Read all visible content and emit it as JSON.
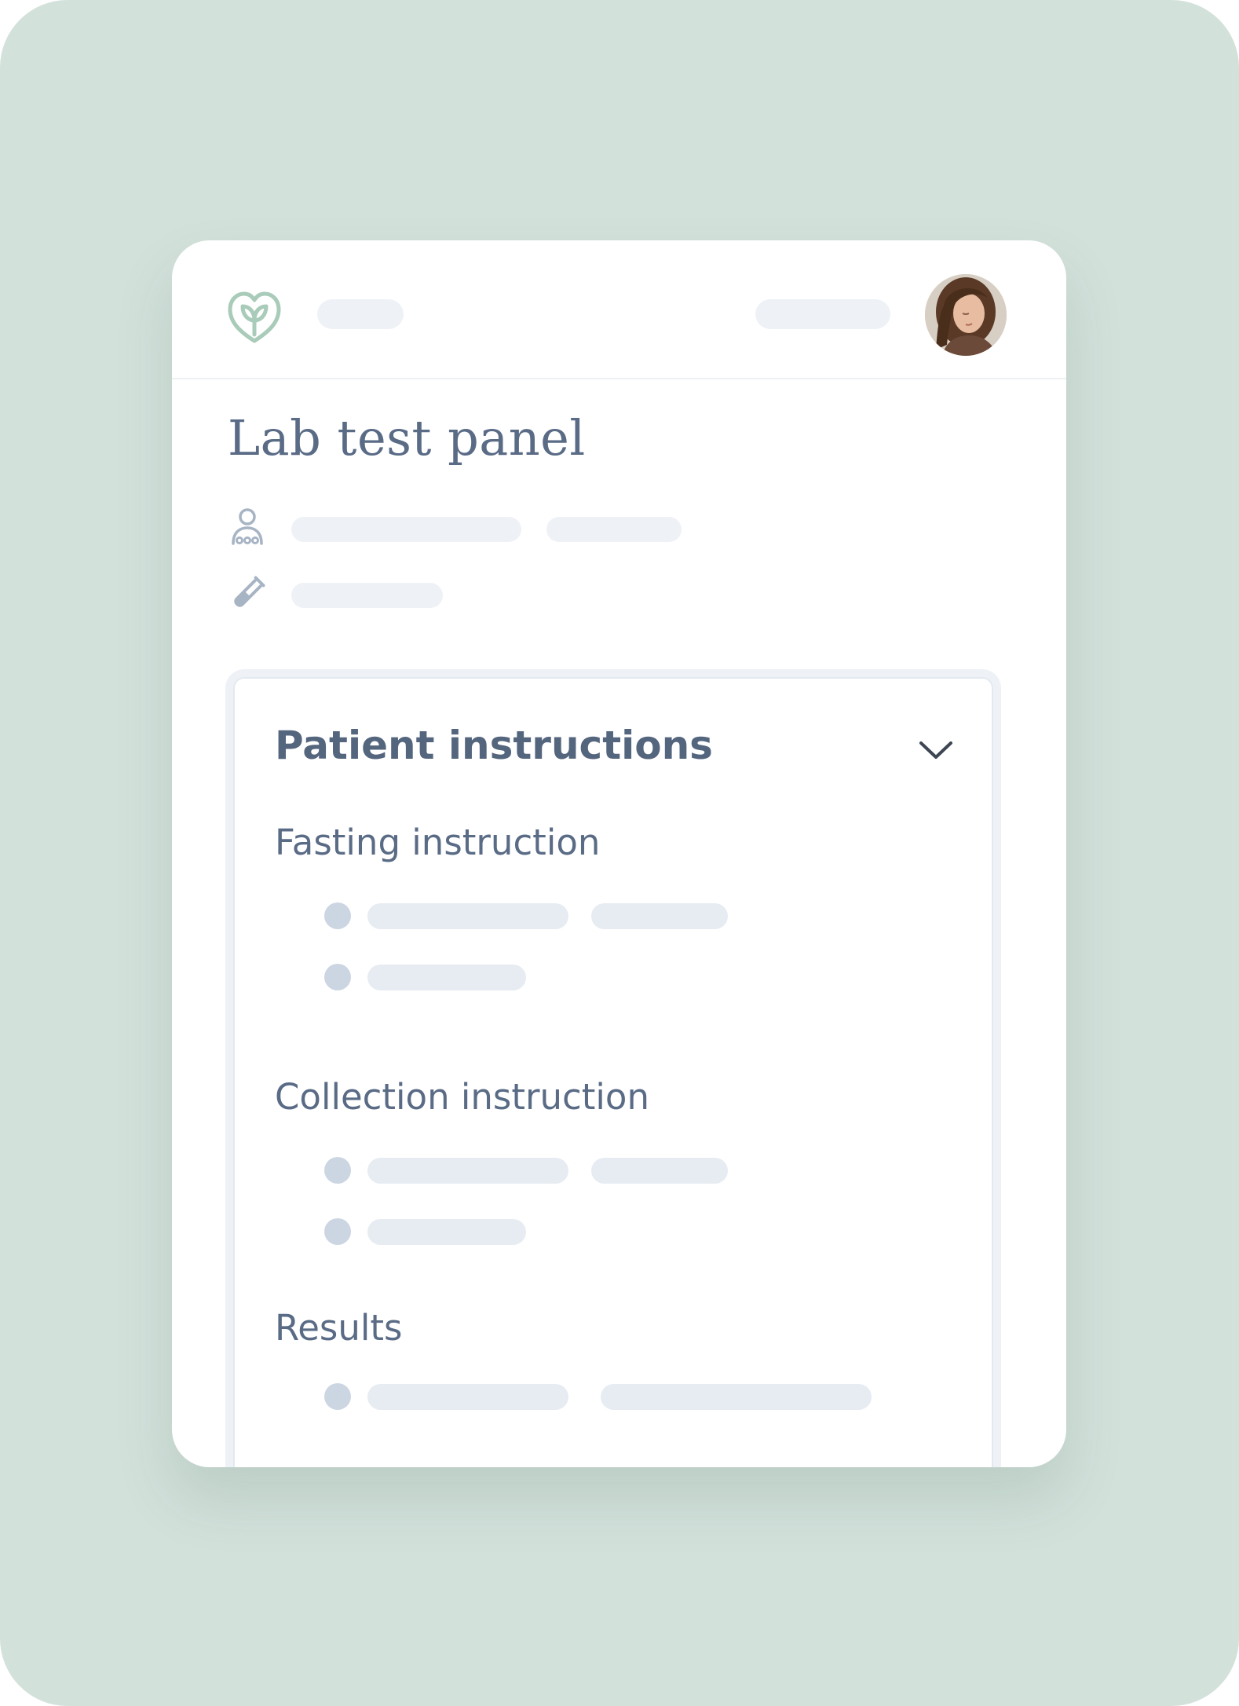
{
  "card": {
    "page_title": "Lab test panel",
    "icons": {
      "logo": "leaf-heart-logo",
      "avatar": "user-avatar-photo",
      "meta_row_1": "patient-icon",
      "meta_row_2": "test-tube-icon",
      "panel_toggle": "chevron-down-icon"
    }
  },
  "panel": {
    "title": "Patient instructions",
    "sections": [
      {
        "title": "Fasting instruction"
      },
      {
        "title": "Collection instruction"
      },
      {
        "title": "Results"
      }
    ]
  },
  "colors": {
    "backdrop": "#d2e1da",
    "card": "#ffffff",
    "text": "#5a6b86",
    "placeholder": "#e7ecf2",
    "bullet": "#ccd6e2",
    "logo": "#a9cbb9"
  }
}
